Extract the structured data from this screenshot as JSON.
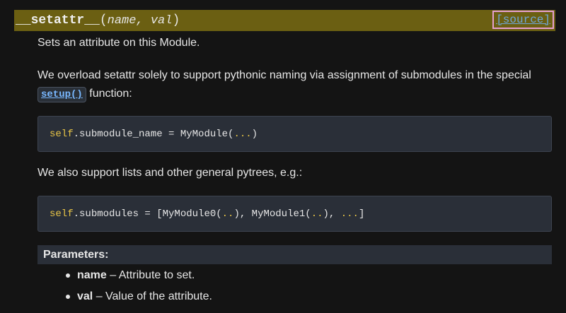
{
  "signature": {
    "name": "__setattr__",
    "open_paren": "(",
    "params": "name, val",
    "close_paren": ")",
    "source_link": "[source]"
  },
  "description": {
    "line1": "Sets an attribute on this Module.",
    "line2_text": "We overload setattr solely to support pythonic naming via assignment of submodules in the special",
    "line2_code": "setup()",
    "line2_suffix": " function:",
    "line3": "We also support lists and other general pytrees, e.g.:"
  },
  "code1": {
    "self": "self",
    "rest": ".submodule_name = MyModule(",
    "ellipsis": "...",
    "close": ")"
  },
  "code2": {
    "self": "self",
    "part1": ".submodules = [MyModule0(",
    "dots1": "..",
    "part2": "), MyModule1(",
    "dots2": "..",
    "part3": "), ",
    "ellipsis": "...",
    "close": "]"
  },
  "parameters": {
    "heading": "Parameters:",
    "items": [
      {
        "name": "name",
        "desc": " – Attribute to set."
      },
      {
        "name": "val",
        "desc": " – Value of the attribute."
      }
    ]
  },
  "colors": {
    "signature_bg": "#6b5f12",
    "code_bg": "#2a2f38",
    "link": "#6fa8dc",
    "keyword": "#e8c547"
  }
}
